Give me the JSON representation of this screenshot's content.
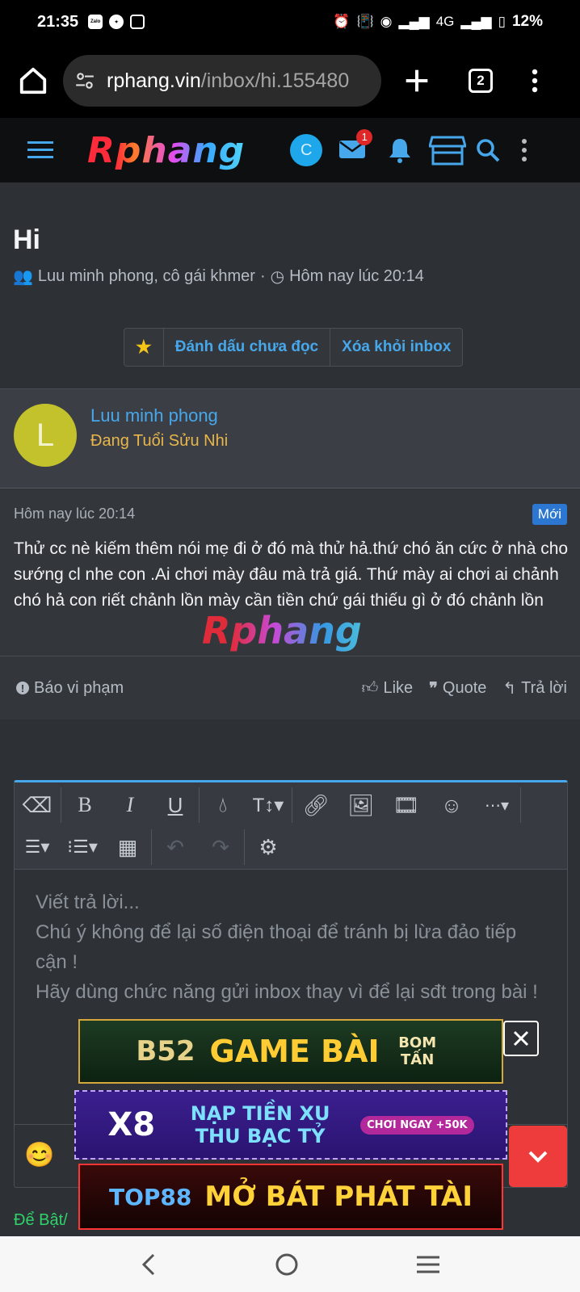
{
  "status_bar": {
    "time": "21:35",
    "notification_apps": [
      "zalo",
      "messenger",
      "instagram"
    ],
    "network": "4G",
    "battery": "12%"
  },
  "browser": {
    "url_domain": "rphang.vin",
    "url_path": "/inbox/hi.155480",
    "tab_count": "2"
  },
  "site": {
    "logo": "Rphang",
    "user_initial": "C",
    "inbox_badge": "1"
  },
  "thread": {
    "title": "Hi",
    "participants": "Luu minh phong, cô gái khmer",
    "time": "Hôm nay lúc 20:14",
    "actions": {
      "mark_unread": "Đánh dấu chưa đọc",
      "remove_inbox": "Xóa khỏi inbox"
    }
  },
  "message": {
    "author_initial": "L",
    "author": "Luu minh phong",
    "author_title": "Đang Tuổi Sửu Nhi",
    "date": "Hôm nay lúc 20:14",
    "new_label": "Mới",
    "text": "Thử cc nè kiếm thêm nói mẹ đi ở đó mà thử hả.thứ chó ăn cức ở nhà cho sướng cl nhe con .Ai chơi mày đâu mà trả giá. Thứ mày ai chơi ai chảnh chó hả con riết chảnh lồn mày cần tiền chứ gái thiếu gì ở đó chảnh lồn",
    "watermark": "Rphang",
    "report": "Báo vi phạm",
    "like": "Like",
    "quote": "Quote",
    "reply": "Trả lời"
  },
  "editor": {
    "placeholder_lines": [
      "Viết trả lời...",
      "Chú ý không để lại số điện thoại để tránh bị lừa đảo tiếp cận !",
      "Hãy dùng chức năng gửi inbox thay vì để lại sđt trong bài !"
    ],
    "hint": "Để Bật/"
  },
  "ads": {
    "ad1_brand": "B52",
    "ad1_text": "GAME BÀI",
    "ad1_tag": "BOM TẤN",
    "ad2_brand": "X8",
    "ad2_text": "NẠP TIỀN XU THU BẠC TỶ",
    "ad2_tag": "CHƠI NGAY +50K",
    "ad3_brand": "TOP88",
    "ad3_text": "MỞ BÁT PHÁT TÀI"
  },
  "colors": {
    "accent": "#47a7eb",
    "badge": "#e02727",
    "new_badge": "#2b77d1",
    "author_title": "#e8b64a",
    "hint": "#2fd36a"
  }
}
